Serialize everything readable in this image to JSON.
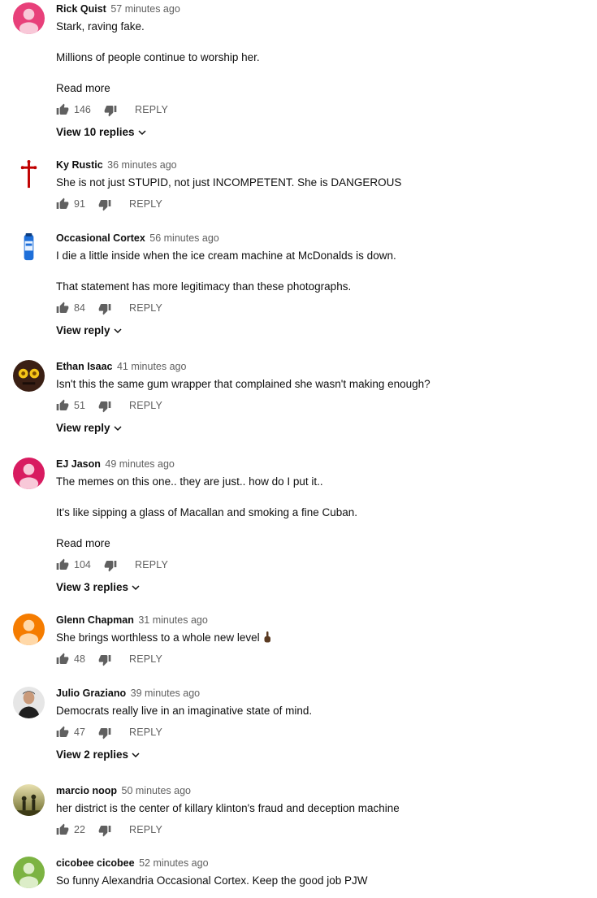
{
  "comments": [
    {
      "author": "Rick Quist",
      "time": "57 minutes ago",
      "lines": [
        "Stark, raving fake.",
        "Millions of people continue to worship her."
      ],
      "read_more": "Read more",
      "likes": "146",
      "reply": "REPLY",
      "replies": "View 10 replies",
      "avatar_color": "#e8407a"
    },
    {
      "author": "Ky Rustic",
      "time": "36 minutes ago",
      "lines": [
        "She is not just STUPID, not just INCOMPETENT. She is DANGEROUS"
      ],
      "likes": "91",
      "reply": "REPLY",
      "avatar_color": "#c00000"
    },
    {
      "author": "Occasional Cortex",
      "time": "56 minutes ago",
      "lines": [
        "I die a little inside when the ice cream machine at McDonalds is down.",
        "That statement has more legitimacy than these photographs."
      ],
      "likes": "84",
      "reply": "REPLY",
      "replies": "View reply",
      "avatar_color": "#1e6fd9"
    },
    {
      "author": "Ethan Isaac",
      "time": "41 minutes ago",
      "lines": [
        "Isn't this the same gum wrapper that complained she wasn't making enough?"
      ],
      "likes": "51",
      "reply": "REPLY",
      "replies": "View reply",
      "avatar_color": "#3a1f14"
    },
    {
      "author": "EJ Jason",
      "time": "49 minutes ago",
      "lines": [
        "The memes on this one.. they are just.. how do I put it..",
        "It's like sipping a glass of Macallan and smoking a fine Cuban."
      ],
      "read_more": "Read more",
      "likes": "104",
      "reply": "REPLY",
      "replies": "View 3 replies",
      "avatar_color": "#d81b60"
    },
    {
      "author": "Glenn Chapman",
      "time": "31 minutes ago",
      "lines": [
        "She brings worthless to a whole new level"
      ],
      "finger": true,
      "likes": "48",
      "reply": "REPLY",
      "avatar_color": "#f57c00"
    },
    {
      "author": "Julio Graziano",
      "time": "39 minutes ago",
      "lines": [
        "Democrats really live in an imaginative state of mind."
      ],
      "likes": "47",
      "reply": "REPLY",
      "replies": "View 2 replies",
      "avatar_color": "#2b2b2b"
    },
    {
      "author": "marcio noop",
      "time": "50 minutes ago",
      "lines": [
        "her district is the center of killary klinton's fraud and deception machine"
      ],
      "likes": "22",
      "reply": "REPLY",
      "avatar_color": "#8a7d3a"
    },
    {
      "author": "cicobee cicobee",
      "time": "52 minutes ago",
      "lines": [
        "So funny Alexandria Occasional Cortex. Keep the good job PJW"
      ],
      "avatar_color": "#7cb342"
    }
  ]
}
